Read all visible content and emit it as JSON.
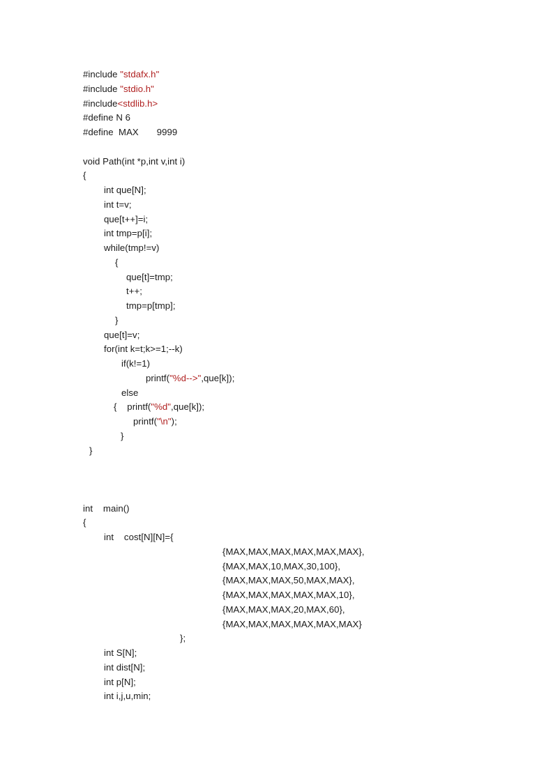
{
  "document": {
    "background_color": "#ffffff",
    "text_color": "#1a1a1a",
    "string_literal_color": "#b02020",
    "language": "C"
  },
  "code": {
    "lines": [
      {
        "id": "line-1",
        "indent": 0,
        "segments": [
          {
            "t": "#include ",
            "s": false
          },
          {
            "t": "\"stdafx.h\"",
            "s": true
          }
        ]
      },
      {
        "id": "line-2",
        "indent": 0,
        "segments": [
          {
            "t": "#include ",
            "s": false
          },
          {
            "t": "\"stdio.h\"",
            "s": true
          }
        ]
      },
      {
        "id": "line-3",
        "indent": 0,
        "segments": [
          {
            "t": "#include",
            "s": false
          },
          {
            "t": "<stdlib.h>",
            "s": true
          }
        ]
      },
      {
        "id": "line-4",
        "indent": 0,
        "segments": [
          {
            "t": "#define N 6",
            "s": false
          }
        ]
      },
      {
        "id": "line-5",
        "indent": 0,
        "segments": [
          {
            "t": "#define  MAX       9999",
            "s": false
          }
        ]
      },
      {
        "id": "line-6",
        "indent": 0,
        "segments": [
          {
            "t": "",
            "s": false
          }
        ]
      },
      {
        "id": "line-7",
        "indent": 0,
        "segments": [
          {
            "t": "void Path(int *p,int v,int i)",
            "s": false
          }
        ]
      },
      {
        "id": "line-8",
        "indent": 0,
        "segments": [
          {
            "t": "{",
            "s": false
          }
        ]
      },
      {
        "id": "line-9",
        "indent": 30,
        "segments": [
          {
            "t": "int que[N];",
            "s": false
          }
        ]
      },
      {
        "id": "line-10",
        "indent": 30,
        "segments": [
          {
            "t": "int t=v;",
            "s": false
          }
        ]
      },
      {
        "id": "line-11",
        "indent": 30,
        "segments": [
          {
            "t": "que[t++]=i;",
            "s": false
          }
        ]
      },
      {
        "id": "line-12",
        "indent": 30,
        "segments": [
          {
            "t": "int tmp=p[i];",
            "s": false
          }
        ]
      },
      {
        "id": "line-13",
        "indent": 30,
        "segments": [
          {
            "t": "while(tmp!=v)",
            "s": false
          }
        ]
      },
      {
        "id": "line-14",
        "indent": 46,
        "segments": [
          {
            "t": "{",
            "s": false
          }
        ]
      },
      {
        "id": "line-15",
        "indent": 62,
        "segments": [
          {
            "t": "que[t]=tmp;",
            "s": false
          }
        ]
      },
      {
        "id": "line-16",
        "indent": 62,
        "segments": [
          {
            "t": "t++;",
            "s": false
          }
        ]
      },
      {
        "id": "line-17",
        "indent": 62,
        "segments": [
          {
            "t": "tmp=p[tmp];",
            "s": false
          }
        ]
      },
      {
        "id": "line-18",
        "indent": 46,
        "segments": [
          {
            "t": "}",
            "s": false
          }
        ]
      },
      {
        "id": "line-19",
        "indent": 30,
        "segments": [
          {
            "t": "que[t]=v;",
            "s": false
          }
        ]
      },
      {
        "id": "line-20",
        "indent": 30,
        "segments": [
          {
            "t": "for(int k=t;k>=1;--k)",
            "s": false
          }
        ]
      },
      {
        "id": "line-21",
        "indent": 55,
        "segments": [
          {
            "t": "if(k!=1)",
            "s": false
          }
        ]
      },
      {
        "id": "line-22",
        "indent": 90,
        "segments": [
          {
            "t": "printf(",
            "s": false
          },
          {
            "t": "\"%d-->\"",
            "s": true
          },
          {
            "t": ",que[k]);",
            "s": false
          }
        ]
      },
      {
        "id": "line-23",
        "indent": 55,
        "segments": [
          {
            "t": "else",
            "s": false
          }
        ]
      },
      {
        "id": "line-24",
        "indent": 44,
        "segments": [
          {
            "t": "{    printf(",
            "s": false
          },
          {
            "t": "\"%d\"",
            "s": true
          },
          {
            "t": ",que[k]);",
            "s": false
          }
        ]
      },
      {
        "id": "line-25",
        "indent": 72,
        "segments": [
          {
            "t": "printf(",
            "s": false
          },
          {
            "t": "\"\\n\"",
            "s": true
          },
          {
            "t": ");",
            "s": false
          }
        ]
      },
      {
        "id": "line-26",
        "indent": 54,
        "segments": [
          {
            "t": "}",
            "s": false
          }
        ]
      },
      {
        "id": "line-27",
        "indent": 9,
        "segments": [
          {
            "t": "}",
            "s": false
          }
        ]
      },
      {
        "id": "line-28",
        "indent": 0,
        "segments": [
          {
            "t": "",
            "s": false
          }
        ]
      },
      {
        "id": "line-29",
        "indent": 0,
        "segments": [
          {
            "t": "",
            "s": false
          }
        ]
      },
      {
        "id": "line-30",
        "indent": 0,
        "segments": [
          {
            "t": "",
            "s": false
          }
        ]
      },
      {
        "id": "line-31",
        "indent": 0,
        "segments": [
          {
            "t": "int    main()",
            "s": false
          }
        ]
      },
      {
        "id": "line-32",
        "indent": 0,
        "segments": [
          {
            "t": "{",
            "s": false
          }
        ]
      },
      {
        "id": "line-33",
        "indent": 30,
        "segments": [
          {
            "t": "int    cost[N][N]={",
            "s": false
          }
        ]
      },
      {
        "id": "line-34",
        "indent": 200,
        "segments": [
          {
            "t": "{MAX,MAX,MAX,MAX,MAX,MAX},",
            "s": false
          }
        ]
      },
      {
        "id": "line-35",
        "indent": 200,
        "segments": [
          {
            "t": "{MAX,MAX,10,MAX,30,100},",
            "s": false
          }
        ]
      },
      {
        "id": "line-36",
        "indent": 200,
        "segments": [
          {
            "t": "{MAX,MAX,MAX,50,MAX,MAX},",
            "s": false
          }
        ]
      },
      {
        "id": "line-37",
        "indent": 200,
        "segments": [
          {
            "t": "{MAX,MAX,MAX,MAX,MAX,10},",
            "s": false
          }
        ]
      },
      {
        "id": "line-38",
        "indent": 200,
        "segments": [
          {
            "t": "{MAX,MAX,MAX,20,MAX,60},",
            "s": false
          }
        ]
      },
      {
        "id": "line-39",
        "indent": 200,
        "segments": [
          {
            "t": "{MAX,MAX,MAX,MAX,MAX,MAX}",
            "s": false
          }
        ]
      },
      {
        "id": "line-40",
        "indent": 139,
        "segments": [
          {
            "t": "};",
            "s": false
          }
        ]
      },
      {
        "id": "line-41",
        "indent": 30,
        "segments": [
          {
            "t": "int S[N];",
            "s": false
          }
        ]
      },
      {
        "id": "line-42",
        "indent": 30,
        "segments": [
          {
            "t": "int dist[N];",
            "s": false
          }
        ]
      },
      {
        "id": "line-43",
        "indent": 30,
        "segments": [
          {
            "t": "int p[N];",
            "s": false
          }
        ]
      },
      {
        "id": "line-44",
        "indent": 30,
        "segments": [
          {
            "t": "int i,j,u,min;",
            "s": false
          }
        ]
      }
    ]
  }
}
